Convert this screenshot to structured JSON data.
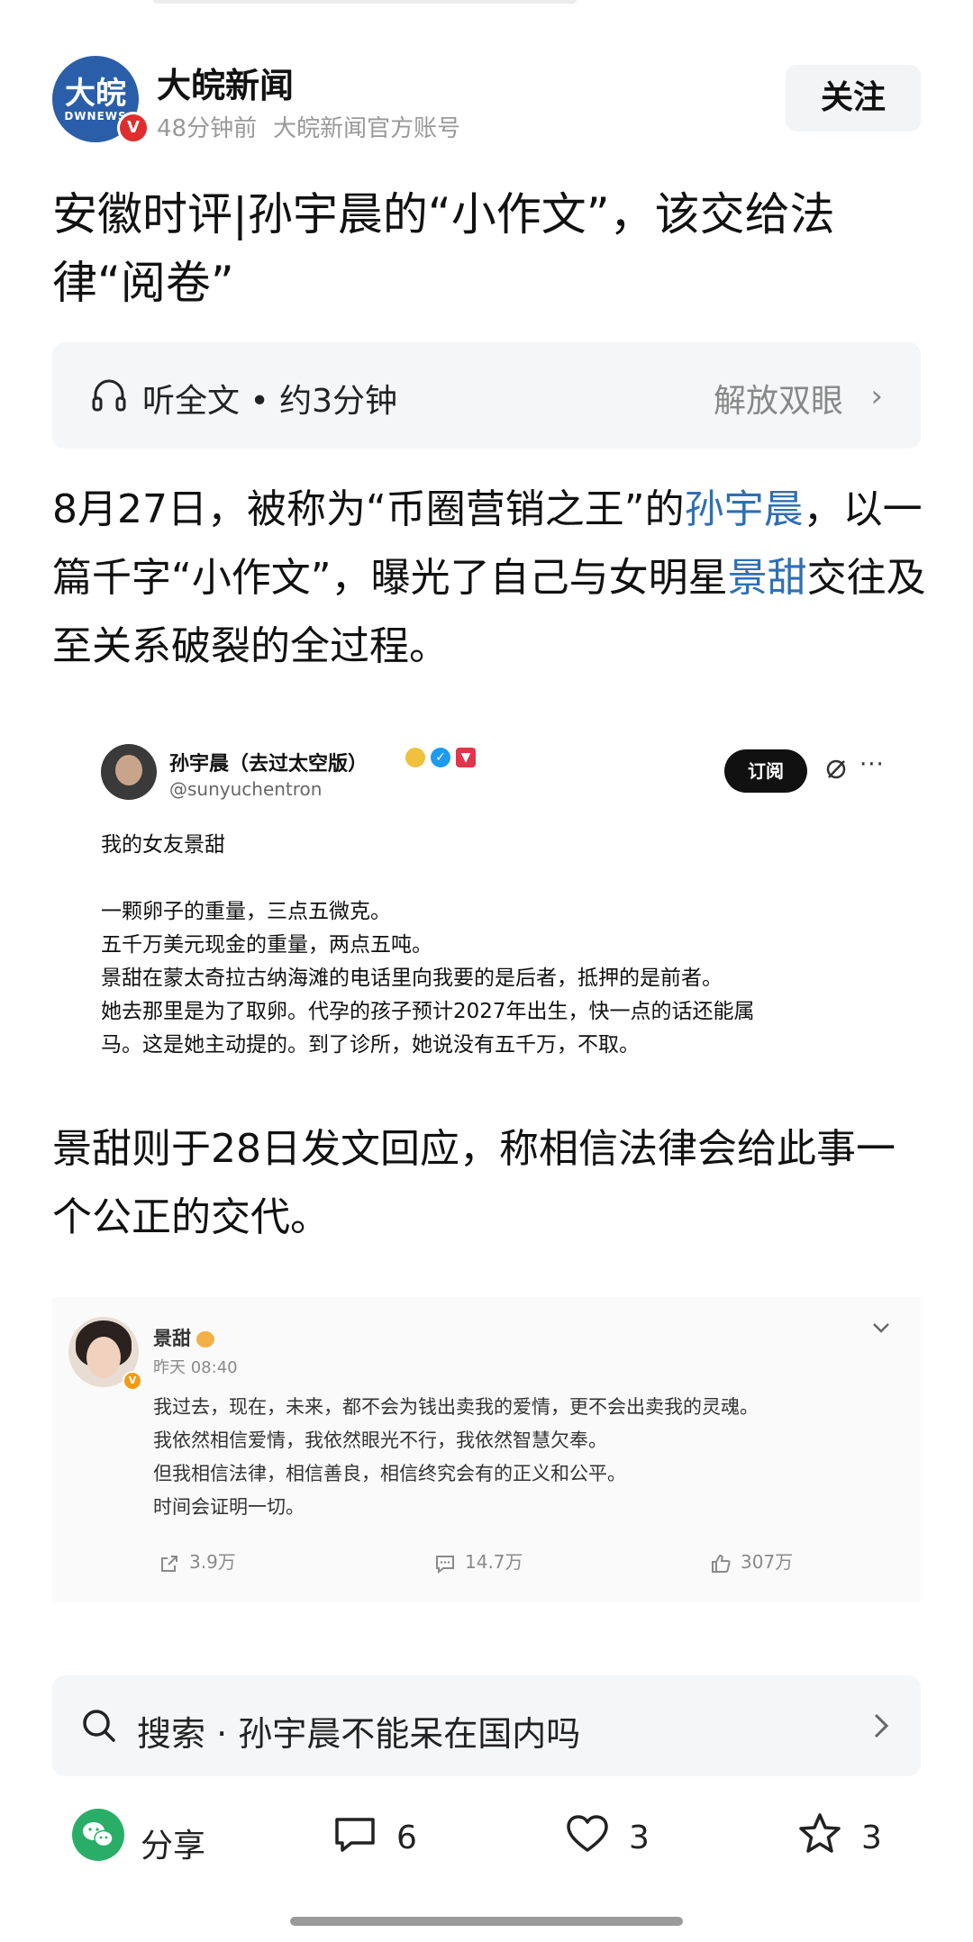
{
  "header": {
    "avatar_text": "大皖",
    "avatar_sub": "DWNEWS",
    "verified_mark": "V",
    "account_name": "大皖新闻",
    "time_ago": "48分钟前",
    "account_desc": "大皖新闻官方账号",
    "follow_label": "关注"
  },
  "article": {
    "title": "安徽时评|孙宇晨的“小作文”，该交给法律“阅卷”",
    "listen": {
      "label": "听全文 • 约3分钟",
      "action": "解放双眼"
    },
    "paragraph1": {
      "t1": "8月27日，被称为“币圈营销之王”的",
      "link1": "孙宇晨",
      "t2": "，以一篇千字“小作文”，曝光了自己与女明星",
      "link2": "景甜",
      "t3": "交往及至关系破裂的全过程。"
    },
    "paragraph2": "景甜则于28日发文回应，称相信法律会给此事一个公正的交代。"
  },
  "tweet": {
    "name": "孙宇晨（去过太空版）",
    "handle": "@sunyuchentron",
    "subscribe_label": "订阅",
    "more": "···",
    "lines": [
      "我的女友景甜",
      "",
      "一颗卵子的重量，三点五微克。",
      "五千万美元现金的重量，两点五吨。",
      "景甜在蒙太奇拉古纳海滩的电话里向我要的是后者，抵押的是前者。",
      "她去那里是为了取卵。代孕的孩子预计2027年出生，快一点的话还能属",
      "马。这是她主动提的。到了诊所，她说没有五千万，不取。"
    ]
  },
  "weibo": {
    "name": "景甜",
    "time": "昨天 08:40",
    "verified_mark": "V",
    "lines": [
      "我过去，现在，未来，都不会为钱出卖我的爱情，更不会出卖我的灵魂。",
      "我依然相信爱情，我依然眼光不行，我依然智慧欠奉。",
      "但我相信法律，相信善良，相信终究会有的正义和公平。",
      "时间会证明一切。"
    ],
    "repost_count": "3.9万",
    "comment_count": "14.7万",
    "like_count": "307万"
  },
  "search": {
    "text": "搜索 · 孙宇晨不能呆在国内吗"
  },
  "bottom": {
    "share_label": "分享",
    "comment_count": "6",
    "like_count": "3",
    "favorite_count": "3"
  }
}
